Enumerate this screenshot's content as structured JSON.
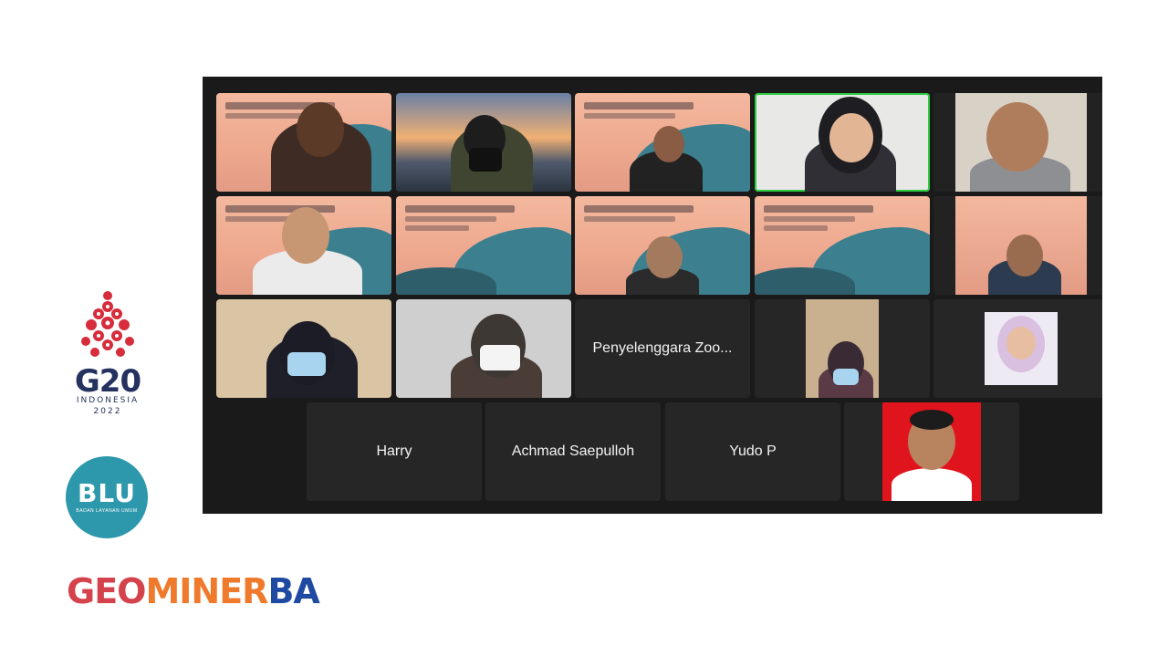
{
  "branding": {
    "g20_title": "G20",
    "g20_country": "INDONESIA",
    "g20_year": "2022",
    "blu_mark": "BLU",
    "blu_sub": "BADAN LAYANAN UMUM",
    "geo_part1": "GEO",
    "geo_part2": "MINER",
    "geo_part3": "BA",
    "colors": {
      "g20": "#d62c3b",
      "navy": "#25315e",
      "blu": "#2d97ab",
      "geo_red": "#d4434b",
      "geo_orange": "#ef7a2c",
      "geo_blue": "#1f4aa2"
    }
  },
  "meeting": {
    "participants": [
      {
        "kind": "slide-video"
      },
      {
        "kind": "bridge-background"
      },
      {
        "kind": "slide-video"
      },
      {
        "kind": "camera-video",
        "active_speaker": true
      },
      {
        "kind": "camera-video"
      },
      {
        "kind": "slide-video"
      },
      {
        "kind": "slide-video"
      },
      {
        "kind": "slide-video"
      },
      {
        "kind": "slide-video"
      },
      {
        "kind": "slide-video"
      },
      {
        "kind": "camera-video"
      },
      {
        "kind": "camera-video"
      },
      {
        "kind": "name-only",
        "name": "Penyelenggara Zoo..."
      },
      {
        "kind": "camera-video"
      },
      {
        "kind": "profile-photo"
      },
      {
        "kind": "name-only",
        "name": "Harry"
      },
      {
        "kind": "name-only",
        "name": "Achmad Saepulloh"
      },
      {
        "kind": "name-only",
        "name": "Yudo P"
      },
      {
        "kind": "profile-photo"
      }
    ]
  }
}
